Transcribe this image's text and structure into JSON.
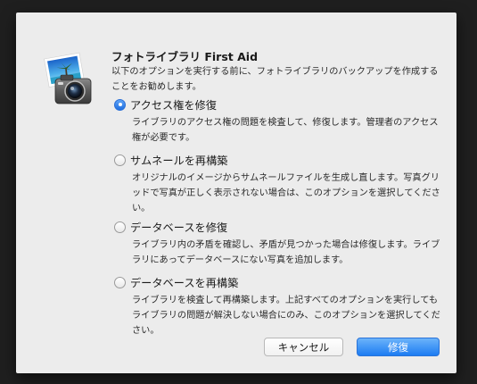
{
  "dialog": {
    "title": "フォトライブラリ First Aid",
    "intro": "以下のオプションを実行する前に、フォトライブラリのバックアップを作成することをお勧めします。",
    "selected_option": "permissions",
    "options": [
      {
        "id": "permissions",
        "label": "アクセス権を修復",
        "description": "ライブラリのアクセス権の問題を検査して、修復します。管理者のアクセス権が必要です。",
        "selected": true
      },
      {
        "id": "thumbnails",
        "label": "サムネールを再構築",
        "description": "オリジナルのイメージからサムネールファイルを生成し直します。写真グリッドで写真が正しく表示されない場合は、このオプションを選択してください。",
        "selected": false
      },
      {
        "id": "repair-db",
        "label": "データベースを修復",
        "description": "ライブラリ内の矛盾を確認し、矛盾が見つかった場合は修復します。ライブラリにあってデータベースにない写真を追加します。",
        "selected": false
      },
      {
        "id": "rebuild-db",
        "label": "データベースを再構築",
        "description": "ライブラリを検査して再構築します。上記すべてのオプションを実行してもライブラリの問題が解決しない場合にのみ、このオプションを選択してください。",
        "selected": false
      }
    ],
    "buttons": {
      "cancel": "キャンセル",
      "primary": "修復"
    },
    "icons": {
      "app": "iphoto-camera-icon",
      "radio_selected": "radio-selected-icon",
      "radio_unselected": "radio-unselected-icon"
    },
    "colors": {
      "accent": "#1f6fe0",
      "dialog_background": "#ececec",
      "backdrop": "#1f1f1f"
    }
  }
}
